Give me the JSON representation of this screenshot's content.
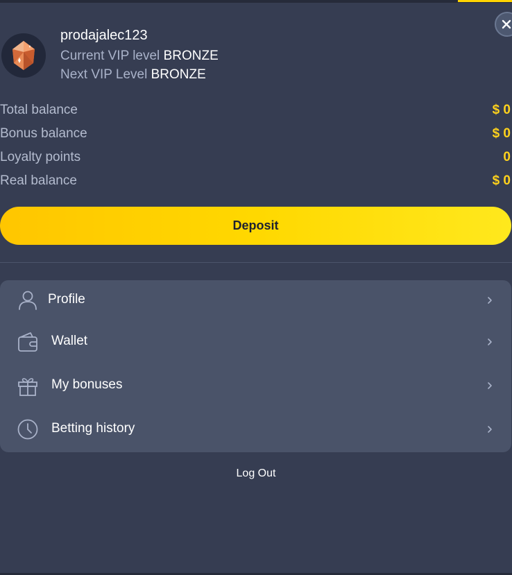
{
  "user": {
    "username": "prodajalec123",
    "avatar_icon": "orange-gem-icon",
    "current_vip_label": "Current VIP level",
    "current_vip_value": "BRONZE",
    "next_vip_label": "Next VIP Level",
    "next_vip_value": "BRONZE"
  },
  "balances": [
    {
      "label": "Total balance",
      "value": "$ 0"
    },
    {
      "label": "Bonus balance",
      "value": "$ 0"
    },
    {
      "label": "Loyalty points",
      "value": "0"
    },
    {
      "label": "Real balance",
      "value": "$ 0"
    }
  ],
  "deposit_label": "Deposit",
  "menu": [
    {
      "label": "Profile",
      "icon": "user-icon"
    },
    {
      "label": "Wallet",
      "icon": "wallet-icon"
    },
    {
      "label": "My bonuses",
      "icon": "gift-icon"
    },
    {
      "label": "Betting history",
      "icon": "clock-icon"
    }
  ],
  "logout_label": "Log Out",
  "colors": {
    "panel_bg": "#363d52",
    "menu_bg": "#4a5369",
    "accent_yellow": "#ffd21c",
    "deposit_gradient_start": "#ffc600",
    "deposit_gradient_end": "#ffe81d"
  }
}
